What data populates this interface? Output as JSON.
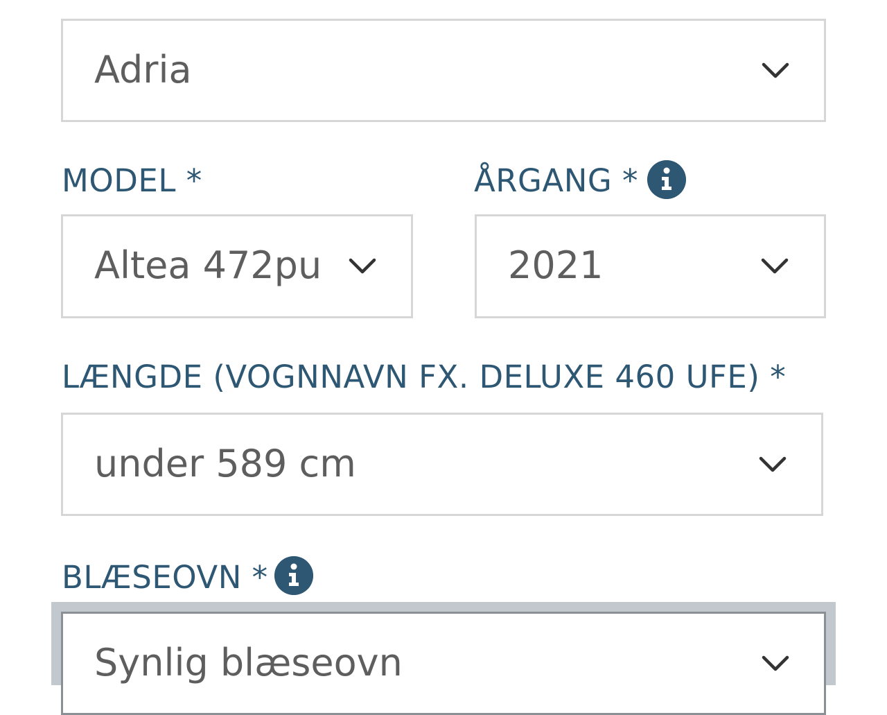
{
  "brand_select": {
    "value": "Adria"
  },
  "model": {
    "label": "MODEL *",
    "value": "Altea 472pu"
  },
  "year": {
    "label": "ÅRGANG *",
    "value": "2021",
    "info_icon": "info-icon"
  },
  "length": {
    "label": "LÆNGDE (VOGNNAVN FX. DELUXE 460 UFE) *",
    "value": "under 589 cm"
  },
  "heater": {
    "label": "BLÆSEOVN *",
    "value": "Synlig blæseovn",
    "info_icon": "info-icon"
  },
  "colors": {
    "label": "#2d5773",
    "value_text": "#5e5e5e",
    "border": "#d6d6d6",
    "focus": "#c3c8ce"
  }
}
